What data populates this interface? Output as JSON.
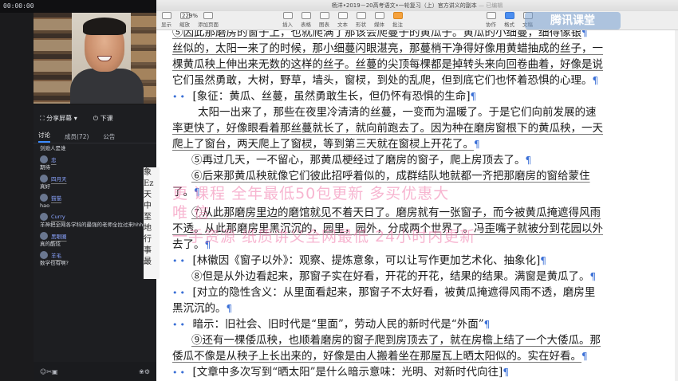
{
  "status_bar": {
    "clock": "00:00:00",
    "indicator": "00"
  },
  "window": {
    "title": "杨洋•2019－20高考语文•一轮复习（上）官方讲义的副本",
    "status": "— 已编辑"
  },
  "toolbar": {
    "zoom": "229%",
    "items": [
      "显示",
      "缩放",
      "添加页面",
      "插入",
      "表格",
      "图表",
      "文本",
      "形状",
      "媒体",
      "批注",
      "协作",
      "格式",
      "文稿"
    ],
    "watermark": "腾讯课堂"
  },
  "chat": {
    "share_label": "分享屏幕",
    "exit_label": "下课",
    "tabs": [
      "讨论",
      "成员(72)",
      "公告"
    ],
    "messages": [
      {
        "user": "",
        "text": "剑勋人是谁"
      },
      {
        "user": "忠",
        "text": "期待"
      },
      {
        "user": "四月天",
        "text": "真好"
      },
      {
        "user": "猫猫",
        "text": "hao"
      },
      {
        "user": "Curry",
        "text": "羊神把全网各学科的最强的老师全拉过来hhh"
      },
      {
        "user": "黑眼圈",
        "text": "真的酷炫"
      },
      {
        "user": "羊毛",
        "text": "数学也有啊?"
      }
    ],
    "footer_icons": [
      "emoji-icon",
      "scissors-icon",
      "image-icon",
      "flower-icon",
      "settings-icon"
    ]
  },
  "behind_doc": [
    "象",
    "Ez",
    "天",
    "中",
    "至",
    "地",
    "行",
    "事",
    "最"
  ],
  "document_lines": [
    "⑤因此那磨房的窗子上，也就爬满了那该会爬蔓子的黄瓜子。黄瓜的小细蔓，细得像银",
    "丝似的，太阳一来了的时候，那小细蔓闪眼湛亮，那蔓梢干净得好像用黄蜡抽成的丝子，一",
    "棵黄瓜秧上伸出来无数的这样的丝子。丝蔓的尖顶每棵都是掉转头来向回卷曲着，好像是说",
    "它们虽然勇敢，大树，野草，墙头，窗棂，到处的乱爬，但到底它们也怀着恐惧的心理。",
    "[象征：黄瓜、丝蔓，虽然勇敢生长，但仍怀有恐惧的生命]",
    "太阳一出来了，那些在夜里冷清清的丝蔓，一变而为温暖了。于是它们向前发展的速",
    "率更快了，好像眼看着那丝蔓就长了，就向前跑去了。因为种在磨房窗根下的黄瓜秧，一天",
    "爬上了窗台，两天爬上了窗棂，等到第三天就在窗棂上开花了。",
    "⑤再过几天，一不留心，那黄瓜梗经过了磨房的窗子，爬上房顶去了。",
    "⑥后来那黄瓜秧就像它们彼此招呼着似的，成群结队地就都一齐把那磨房的窗给蒙住",
    "了。",
    "⑦从此那磨房里边的磨馆就见不着天日了。磨房就有一张窗子，而今被黄瓜掩遮得风雨",
    "不透。从此那磨房里黑沉沉的，园里，园外，分成两个世界了。冯歪嘴子就被分到花园以外",
    "去了。",
    "[林徽因《窗子以外》：观察、提炼意象，可以让写作更加艺术化、抽象化]",
    "⑧但是从外边看起来，那窗子实在好看，开花的开花，结果的结果。满窗是黄瓜了。",
    "[对立的隐性含义：从里面看起来，那窗子不太好看，被黄瓜掩遮得风雨不透，磨房里",
    "黑沉沉的。",
    "暗示：旧社会、旧时代是“里面”，劳动人民的新时代是“外面”",
    "⑨还有一棵倭瓜秧，也顺着磨房的窗子爬到房顶去了，就在房檐上结了一个大倭瓜。那",
    "倭瓜不像是从秧子上长出来的，好像是由人搬着坐在那屋瓦上晒太阳似的。实在好看。",
    "[文章中多次写到“晒太阳”是什么暗示意味：光明、对新时代向往]"
  ],
  "overlay_lines": [
    "更    课程      全年最低50包更新      多买优惠大",
    "唯  信                                         ",
    "一手资源  纸质讲义全网最低    24小时内更新"
  ]
}
